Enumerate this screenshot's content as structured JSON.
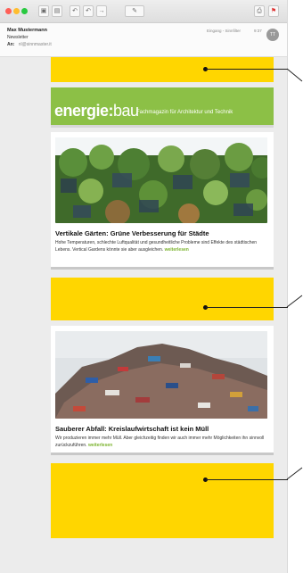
{
  "header": {
    "sender": "Max Mustermann",
    "subject": "Newsletter",
    "to_label": "An:",
    "to_address": "nl@sinnmaster.it",
    "folder": "Eingang - Sinnfilter",
    "time": "9:37",
    "avatar_initials": "TT"
  },
  "banner": {
    "logo_left": "energie",
    "logo_colon": ":",
    "logo_right": "bau",
    "tagline": "Fachmagazin für Architektur und Technik",
    "background": "#8cc046"
  },
  "articles": [
    {
      "title": "Vertikale Gärten: Grüne Verbesserung für Städte",
      "text": "Hohe Temperaturen, schlechte Luftqualität und gesundheitliche Probleme sind Effekte des städtischen Lebens. Vertical Gardens könnte sie aber ausgleichen.",
      "read_more": "weiterlesen",
      "image": "green-wall-building"
    },
    {
      "title": "Sauberer Abfall: Kreislaufwirtschaft ist kein Müll",
      "text": "Wir produzieren immer mehr Müll. Aber gleichzeitig finden wir auch immer mehr Möglichkeiten ihn sinnvoll zurückzuführen.",
      "read_more": "weiterlesen",
      "image": "scrap-heap"
    }
  ],
  "colors": {
    "ad_yellow": "#ffd600",
    "link_green": "#7bb32e"
  }
}
